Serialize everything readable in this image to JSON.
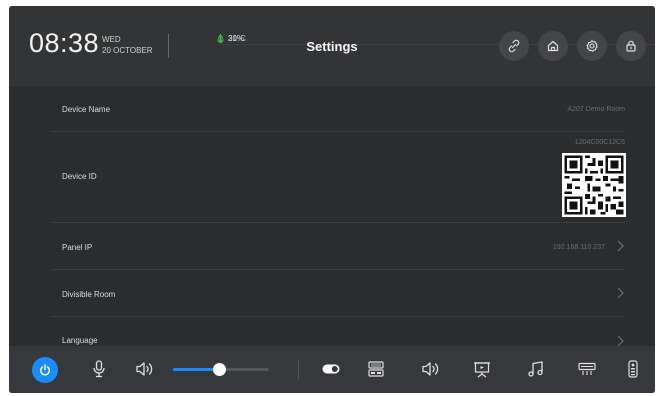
{
  "header": {
    "time": "08:38",
    "weekday": "WED",
    "date": "20 OCTOBER",
    "temperature": "31°C",
    "humidity": "20%",
    "title": "Settings",
    "buttons": [
      "link-icon",
      "home-icon",
      "gear-icon",
      "lock-icon"
    ]
  },
  "settings": [
    {
      "label": "Device Name",
      "value": "A207 Demo Room",
      "chevron": false
    },
    {
      "label": "Device ID",
      "value": "1204C00C12C5",
      "qr": true,
      "chevron": false
    },
    {
      "label": "Panel IP",
      "value": "192.168.110.237",
      "chevron": true
    },
    {
      "label": "Divisible Room",
      "value": "",
      "chevron": true
    },
    {
      "label": "Language",
      "value": "",
      "chevron": true
    }
  ],
  "bottom_bar": {
    "icons": [
      "power-icon",
      "microphone-icon",
      "speaker-icon",
      "toggle-icon",
      "switcher-icon",
      "speaker-icon",
      "presentation-icon",
      "music-icon",
      "projector-icon",
      "remote-icon"
    ],
    "volume_level": 0.48,
    "accent": "#1a8cff"
  }
}
